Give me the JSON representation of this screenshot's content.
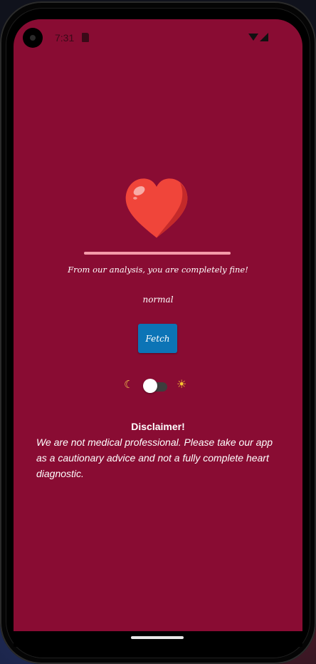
{
  "status_bar": {
    "time": "7:31",
    "icons": [
      "sd-card-icon",
      "wifi-icon",
      "cell-signal-icon"
    ]
  },
  "result": {
    "heart_icon": "heart-icon",
    "heart_color": "#f0453a",
    "progress_fraction": 1.0,
    "message": "From our analysis, you are completely fine!",
    "status": "normal"
  },
  "actions": {
    "fetch_label": "Fetch",
    "fetch_color": "#0c74b6"
  },
  "theme_toggle": {
    "left_icon": "moon-icon",
    "right_icon": "sun-icon",
    "is_on": false
  },
  "disclaimer": {
    "title": "Disclaimer!",
    "body": "We are not medical professional. Please take our app as a cautionary advice and not a fully complete heart diagnostic."
  },
  "colors": {
    "background": "#890c33",
    "progress": "#f49aa9"
  }
}
